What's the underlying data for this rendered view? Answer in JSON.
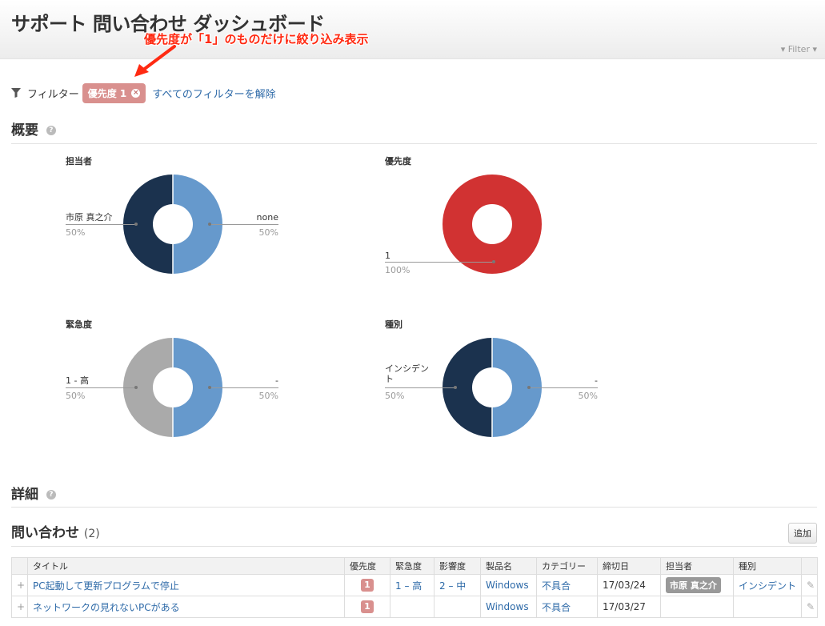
{
  "header": {
    "title": "サポート 問い合わせ ダッシュボード",
    "filter_menu": "Filter"
  },
  "annotation": {
    "text": "優先度が「1」のものだけに絞り込み表示",
    "color": "#ff2a12"
  },
  "filter_bar": {
    "label": "フィルター",
    "chip": "優先度 1",
    "chip_close": "×",
    "clear_all": "すべてのフィルターを解除"
  },
  "overview": {
    "heading": "概要",
    "help": "?",
    "charts": [
      {
        "title": "担当者",
        "slices": [
          {
            "label": "市原 真之介",
            "pct": "50%",
            "value": 50,
            "color": "#6699cc"
          },
          {
            "label": "none",
            "pct": "50%",
            "value": 50,
            "color": "#1b324e"
          }
        ]
      },
      {
        "title": "優先度",
        "slices": [
          {
            "label": "1",
            "pct": "100%",
            "value": 100,
            "color": "#d13232"
          }
        ]
      },
      {
        "title": "緊急度",
        "slices": [
          {
            "label": "1 - 高",
            "pct": "50%",
            "value": 50,
            "color": "#6699cc"
          },
          {
            "label": "-",
            "pct": "50%",
            "value": 50,
            "color": "#aaaaaa"
          }
        ]
      },
      {
        "title": "種別",
        "slices": [
          {
            "label": "インシデント",
            "pct": "50%",
            "value": 50,
            "color": "#6699cc"
          },
          {
            "label": "-",
            "pct": "50%",
            "value": 50,
            "color": "#1b324e"
          }
        ]
      }
    ]
  },
  "details": {
    "heading": "詳細",
    "help": "?"
  },
  "inquiries": {
    "heading": "問い合わせ",
    "count": "(2)",
    "add_button": "追加",
    "columns": [
      "タイトル",
      "優先度",
      "緊急度",
      "影響度",
      "製品名",
      "カテゴリー",
      "締切日",
      "担当者",
      "種別"
    ],
    "rows": [
      {
        "expand": "+",
        "title": "PC起動して更新プログラムで停止",
        "priority": "1",
        "urgency": "1 – 高",
        "impact": "2 – 中",
        "product": "Windows",
        "category": "不具合",
        "due": "17/03/24",
        "assignee": "市原 真之介",
        "type": "インシデント",
        "edit": "✎"
      },
      {
        "expand": "+",
        "title": "ネットワークの見れないPCがある",
        "priority": "1",
        "urgency": "",
        "impact": "",
        "product": "Windows",
        "category": "不具合",
        "due": "17/03/27",
        "assignee": "",
        "type": "",
        "edit": "✎"
      }
    ]
  }
}
